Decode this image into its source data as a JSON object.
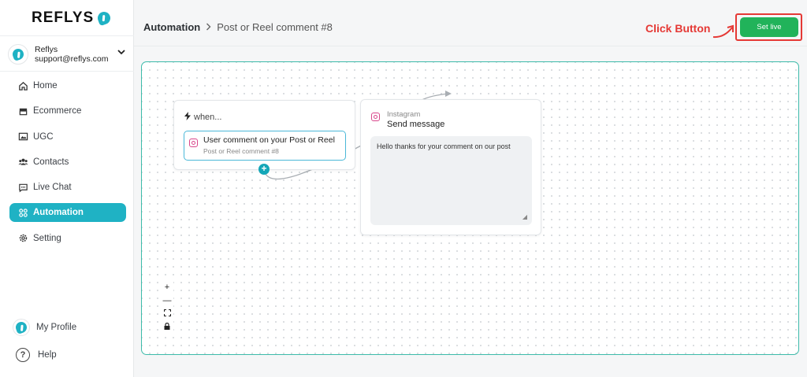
{
  "brand": {
    "name": "REFLYS",
    "accent": "#1fb2c4"
  },
  "account": {
    "name": "Reflys",
    "email": "support@reflys.com"
  },
  "nav": [
    {
      "label": "Home",
      "icon": "home-icon"
    },
    {
      "label": "Ecommerce",
      "icon": "store-icon"
    },
    {
      "label": "UGC",
      "icon": "image-icon"
    },
    {
      "label": "Contacts",
      "icon": "users-icon"
    },
    {
      "label": "Live Chat",
      "icon": "chat-icon"
    },
    {
      "label": "Automation",
      "icon": "automation-icon",
      "active": true
    },
    {
      "label": "Setting",
      "icon": "gear-icon"
    }
  ],
  "bottom_nav": {
    "profile": "My Profile",
    "help": "Help"
  },
  "breadcrumb": {
    "section": "Automation",
    "page": "Post or Reel comment #8"
  },
  "annotation": {
    "text": "Click Button",
    "color": "#e53935"
  },
  "header": {
    "set_live_label": "Set live",
    "set_live_color": "#21b35a"
  },
  "flow": {
    "trigger": {
      "when_label": "when...",
      "title": "User comment on your Post or Reel",
      "subtitle": "Post or Reel comment #8"
    },
    "action": {
      "platform": "Instagram",
      "title": "Send message",
      "message": "Hello thanks for your comment on our post"
    }
  },
  "canvas_controls": [
    "+",
    "—",
    "⛶",
    "🔒"
  ]
}
